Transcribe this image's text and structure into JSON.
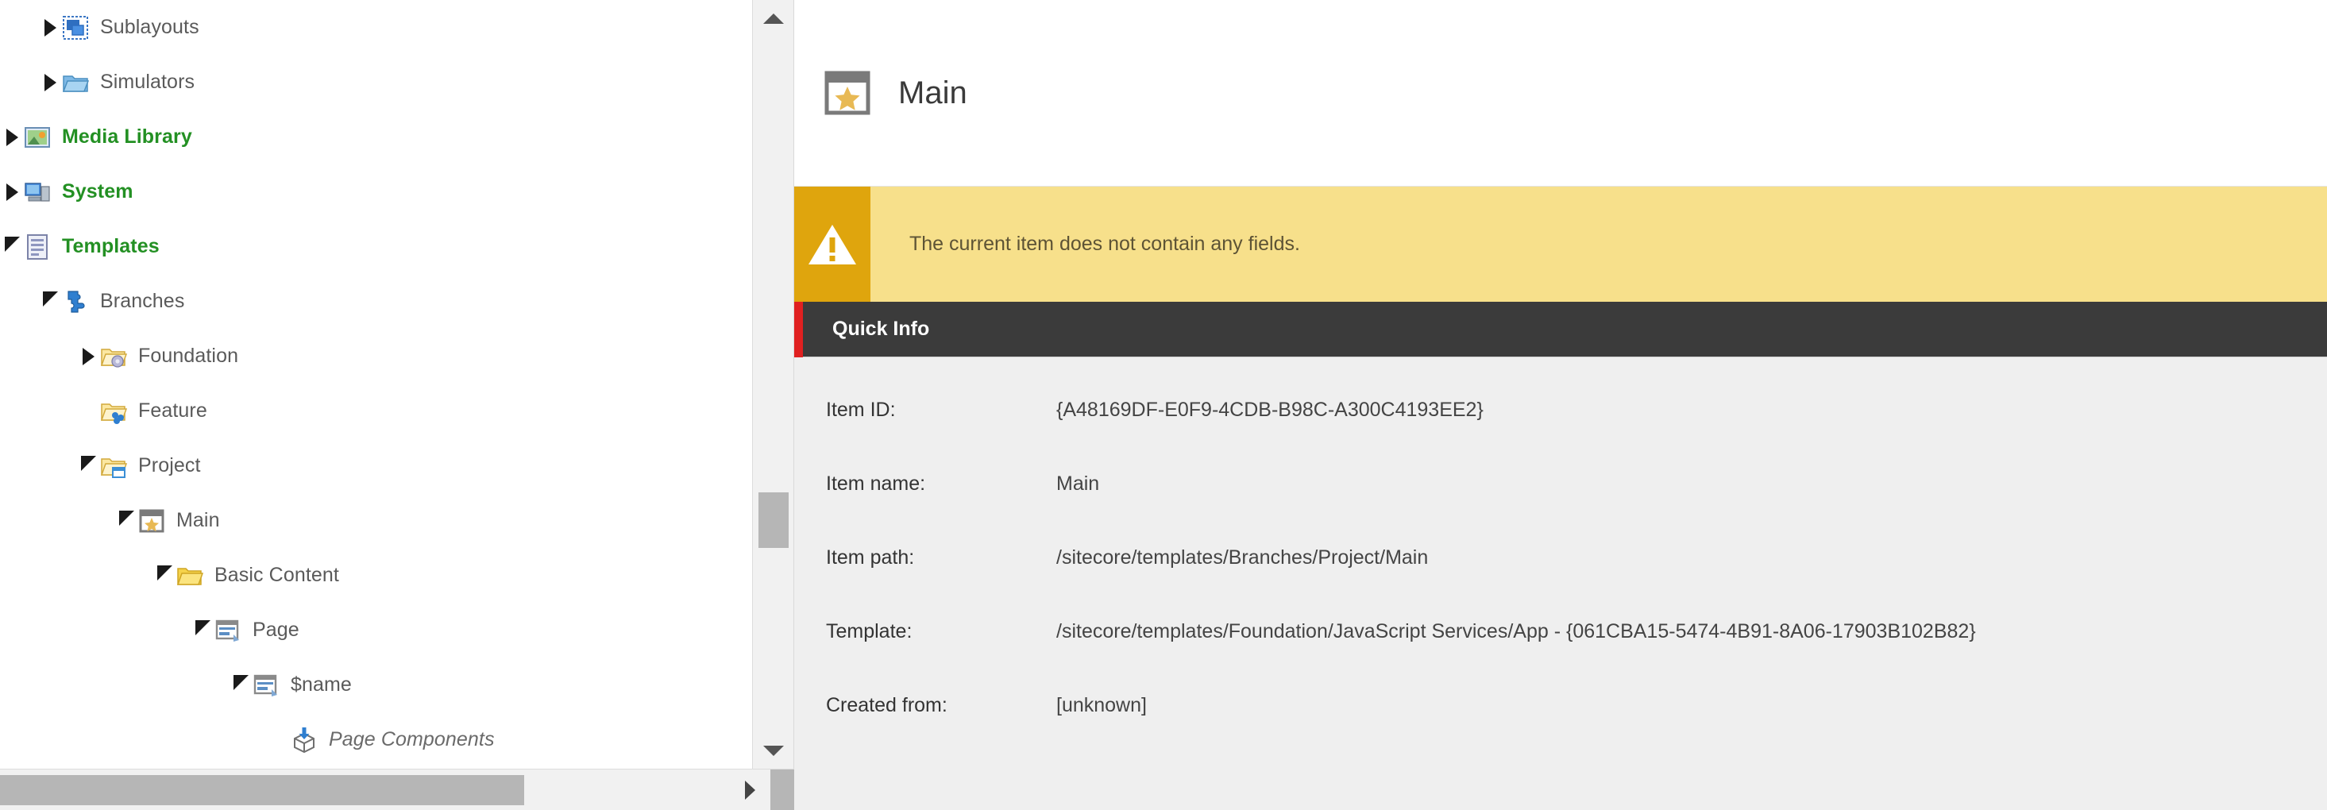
{
  "tree": {
    "items": [
      {
        "label": "Sublayouts",
        "level": 2,
        "state": "collapsed",
        "icon": "sublayouts-icon",
        "style": "normal"
      },
      {
        "label": "Simulators",
        "level": 2,
        "state": "collapsed",
        "icon": "blue-folder-icon",
        "style": "normal"
      },
      {
        "label": "Media Library",
        "level": 1,
        "state": "collapsed",
        "icon": "media-library-icon",
        "style": "green"
      },
      {
        "label": "System",
        "level": 1,
        "state": "collapsed",
        "icon": "system-icon",
        "style": "green"
      },
      {
        "label": "Templates",
        "level": 1,
        "state": "expanded",
        "icon": "templates-icon",
        "style": "green"
      },
      {
        "label": "Branches",
        "level": 2,
        "state": "expanded",
        "icon": "branches-puzzle-icon",
        "style": "normal"
      },
      {
        "label": "Foundation",
        "level": 3,
        "state": "collapsed",
        "icon": "folder-gear-icon",
        "style": "normal"
      },
      {
        "label": "Feature",
        "level": 3,
        "state": "none",
        "icon": "folder-blocks-icon",
        "style": "normal"
      },
      {
        "label": "Project",
        "level": 3,
        "state": "expanded",
        "icon": "folder-window-icon",
        "style": "normal"
      },
      {
        "label": "Main",
        "level": 4,
        "state": "expanded",
        "icon": "branch-star-icon",
        "style": "normal"
      },
      {
        "label": "Basic Content",
        "level": 5,
        "state": "expanded",
        "icon": "yellow-folder-icon",
        "style": "normal"
      },
      {
        "label": "Page",
        "level": 6,
        "state": "expanded",
        "icon": "page-window-icon",
        "style": "normal"
      },
      {
        "label": "$name",
        "level": 7,
        "state": "expanded",
        "icon": "page-window-icon",
        "style": "normal"
      },
      {
        "label": "Page Components",
        "level": 8,
        "state": "none",
        "icon": "package-icon",
        "style": "italic"
      }
    ],
    "vscrollbar": {
      "up": "scroll-up",
      "down": "scroll-down"
    },
    "hscrollbar": {
      "right": "scroll-right"
    }
  },
  "detail": {
    "header": {
      "title": "Main",
      "icon": "branch-star-icon"
    },
    "warning": {
      "icon": "warning-triangle-icon",
      "message": "The current item does not contain any fields."
    },
    "quick_info": {
      "title": "Quick Info"
    },
    "fields": [
      {
        "label": "Item ID:",
        "value": "{A48169DF-E0F9-4CDB-B98C-A300C4193EE2}"
      },
      {
        "label": "Item name:",
        "value": "Main"
      },
      {
        "label": "Item path:",
        "value": "/sitecore/templates/Branches/Project/Main"
      },
      {
        "label": "Template:",
        "value": "/sitecore/templates/Foundation/JavaScript Services/App - {061CBA15-5474-4B91-8A06-17903B102B82}"
      },
      {
        "label": "Created from:",
        "value": "[unknown]"
      }
    ]
  },
  "colors": {
    "tree_green": "#239023",
    "warning_bg": "#f7e08b",
    "warning_icon_bg": "#dfa50d",
    "quickinfo_bg": "#3b3b3b",
    "quickinfo_accent": "#e02020",
    "panel_bg": "#efefef"
  }
}
